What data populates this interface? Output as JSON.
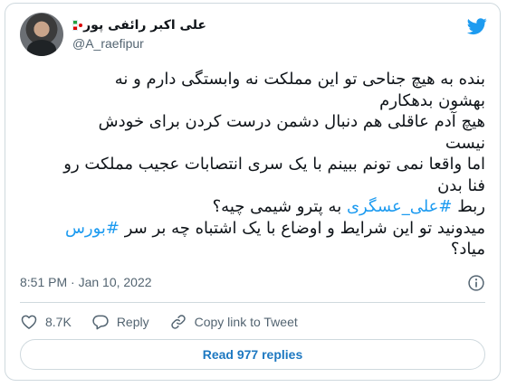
{
  "author": {
    "display_name": "علی اکبر رائفی پور",
    "handle": "@A_raefipur",
    "flag_icon": "iran-flag-icon"
  },
  "tweet": {
    "lines": [
      "بنده به هیچ جناحی تو این مملکت نه وابستگی دارم و نه",
      "بهشون بدهکارم",
      "هیچ آدم عاقلی هم دنبال دشمن درست کردن برای خودش",
      "نیست",
      "اما واقعا نمی تونم ببینم با یک سری انتصابات عجیب مملکت رو",
      "فنا بدن"
    ],
    "line7_prefix": "ربط ",
    "hashtag1": "#علی_عسگری",
    "line7_suffix": " به پترو شیمی چیه؟",
    "line8_prefix": "میدونید تو این شرایط و اوضاع با یک اشتباه چه بر سر ",
    "hashtag2": "#بورس",
    "line9": "میاد؟"
  },
  "meta": {
    "timestamp": "8:51 PM · Jan 10, 2022"
  },
  "actions": {
    "likes": "8.7K",
    "reply_label": "Reply",
    "copy_label": "Copy link to Tweet"
  },
  "replies_button": "Read 977 replies",
  "colors": {
    "accent": "#1d9bf0",
    "like": "#536471",
    "text": "#0f1419",
    "muted": "#536471",
    "border": "#cfd9de"
  },
  "icons": {
    "brand": "twitter-bird-icon",
    "info": "info-icon",
    "like": "heart-icon",
    "reply": "reply-bubble-icon",
    "copy": "link-icon"
  }
}
